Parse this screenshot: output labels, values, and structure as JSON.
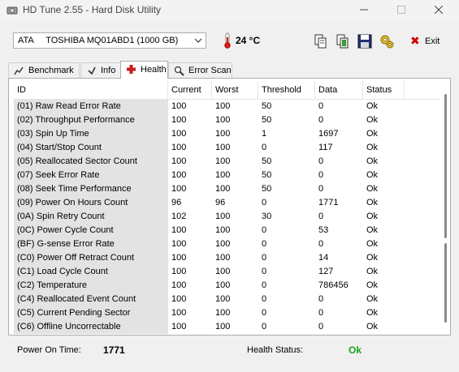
{
  "window": {
    "title": "HD Tune 2.55 - Hard Disk Utility"
  },
  "toolbar": {
    "drive": "ATA     TOSHIBA MQ01ABD1 (1000 GB)",
    "temperature": "24 °C",
    "exit_label": "Exit"
  },
  "tabs": [
    {
      "label": "Benchmark"
    },
    {
      "label": "Info"
    },
    {
      "label": "Health",
      "active": true
    },
    {
      "label": "Error Scan"
    }
  ],
  "health_table": {
    "columns": [
      "ID",
      "Current",
      "Worst",
      "Threshold",
      "Data",
      "Status"
    ],
    "rows": [
      [
        "(01) Raw Read Error Rate",
        "100",
        "100",
        "50",
        "0",
        "Ok"
      ],
      [
        "(02) Throughput Performance",
        "100",
        "100",
        "50",
        "0",
        "Ok"
      ],
      [
        "(03) Spin Up Time",
        "100",
        "100",
        "1",
        "1697",
        "Ok"
      ],
      [
        "(04) Start/Stop Count",
        "100",
        "100",
        "0",
        "117",
        "Ok"
      ],
      [
        "(05) Reallocated Sector Count",
        "100",
        "100",
        "50",
        "0",
        "Ok"
      ],
      [
        "(07) Seek Error Rate",
        "100",
        "100",
        "50",
        "0",
        "Ok"
      ],
      [
        "(08) Seek Time Performance",
        "100",
        "100",
        "50",
        "0",
        "Ok"
      ],
      [
        "(09) Power On Hours Count",
        "96",
        "96",
        "0",
        "1771",
        "Ok"
      ],
      [
        "(0A) Spin Retry Count",
        "102",
        "100",
        "30",
        "0",
        "Ok"
      ],
      [
        "(0C) Power Cycle Count",
        "100",
        "100",
        "0",
        "53",
        "Ok"
      ],
      [
        "(BF) G-sense Error Rate",
        "100",
        "100",
        "0",
        "0",
        "Ok"
      ],
      [
        "(C0) Power Off Retract Count",
        "100",
        "100",
        "0",
        "14",
        "Ok"
      ],
      [
        "(C1) Load Cycle Count",
        "100",
        "100",
        "0",
        "127",
        "Ok"
      ],
      [
        "(C2) Temperature",
        "100",
        "100",
        "0",
        "786456",
        "Ok"
      ],
      [
        "(C4) Reallocated Event Count",
        "100",
        "100",
        "0",
        "0",
        "Ok"
      ],
      [
        "(C5) Current Pending Sector",
        "100",
        "100",
        "0",
        "0",
        "Ok"
      ],
      [
        "(C6) Offline Uncorrectable",
        "100",
        "100",
        "0",
        "0",
        "Ok"
      ]
    ]
  },
  "status_bar": {
    "power_on_label": "Power On Time:",
    "power_on_value": "1771",
    "health_label": "Health Status:",
    "health_value": "Ok",
    "health_color": "#1aa31a"
  }
}
